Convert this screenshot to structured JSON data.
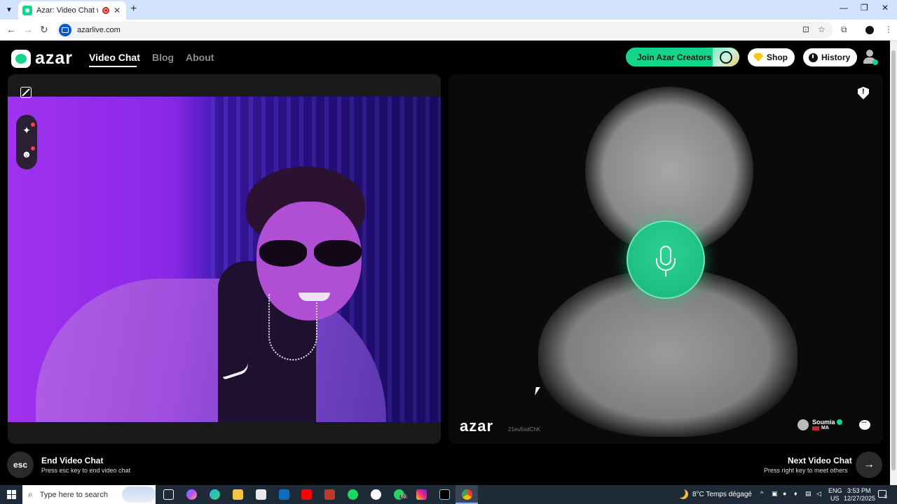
{
  "browser": {
    "tab_title": "Azar: Video Chat with New",
    "tab_close": "✕",
    "new_tab": "+",
    "url": "azarlive.com",
    "window_controls": [
      "—",
      "❐",
      "✕"
    ]
  },
  "header": {
    "logo_text": "azar",
    "nav": [
      {
        "label": "Video Chat",
        "active": true
      },
      {
        "label": "Blog",
        "active": false
      },
      {
        "label": "About",
        "active": false
      }
    ],
    "creators_label": "Join Azar Creators",
    "shop_label": "Shop",
    "history_label": "History"
  },
  "partner_panel": {
    "watermark": "azar",
    "session_id": "21eu5sdChK",
    "partner_name": "Soumia",
    "partner_country": "MA"
  },
  "footer": {
    "esc_key": "esc",
    "end_title": "End Video Chat",
    "end_sub": "Press esc key to end video chat",
    "next_title": "Next Video Chat",
    "next_sub": "Press right key to meet others",
    "next_arrow": "→"
  },
  "taskbar": {
    "search_placeholder": "Type here to search",
    "whatsapp_badge": "61",
    "weather": "8°C  Temps dégagé",
    "lang_top": "ENG",
    "lang_bottom": "US",
    "time": "3:53 PM",
    "date": "12/27/2025",
    "notif_count": "5"
  },
  "colors": {
    "accent": "#14d68a",
    "page_bg": "#000000",
    "taskbar_bg": "#1f2a38"
  }
}
